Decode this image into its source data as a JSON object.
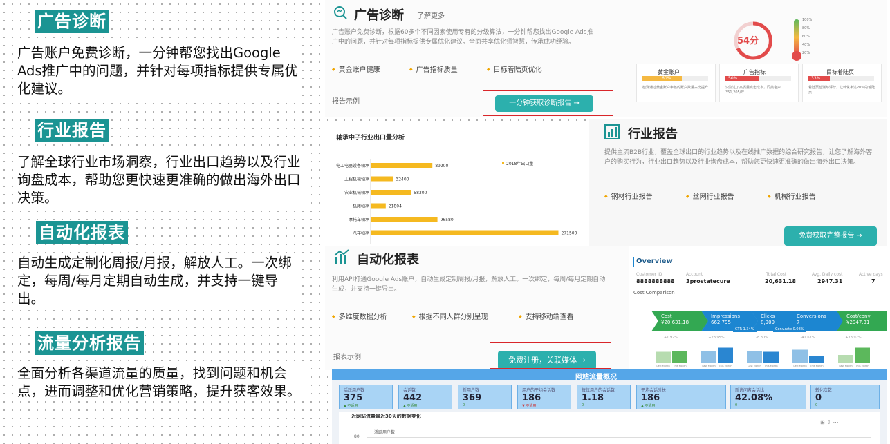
{
  "left": {
    "sections": [
      {
        "title": "广告诊断",
        "desc": "广告账户免费诊断，一分钟帮您找出Google Ads推广中的问题，并针对每项指标提供专属优化建议。"
      },
      {
        "title": "行业报告",
        "desc": "了解全球行业市场洞察，行业出口趋势以及行业询盘成本，帮助您更快速更准确的做出海外出口决策。"
      },
      {
        "title": "自动化报表",
        "desc": "自动生成定制化周报/月报，解放人工。一次绑定，每周/每月定期自动生成，并支持一键导出。"
      },
      {
        "title": "流量分析报告",
        "desc": "全面分析各渠道流量的质量，找到问题和机会点，进而调整和优化营销策略，提升获客效果。"
      }
    ]
  },
  "diag": {
    "title": "广告诊断",
    "learn_more": "了解更多",
    "desc": "广告账户免费诊断，根据60多个不同因素使用专有的分级算法，一分钟帮您找出Google Ads推广中的问题，并针对每项指标提供专属优化建议。全面共享优化师智慧，传承成功经验。",
    "bullets": [
      "黄金账户健康",
      "广告指标质量",
      "目标着陆页优化"
    ],
    "example": "报告示例",
    "button": "一分钟获取诊断报告 →",
    "score": "54分",
    "gauge_labels": [
      "100%",
      "80%",
      "60%",
      "40%",
      "20%"
    ],
    "cards": [
      {
        "name": "黄金账户",
        "pct": "60%",
        "fill": 0.6,
        "color": "#f5b942",
        "text": "检测通过黄金账户审核的账户数量占比提升"
      },
      {
        "name": "广告指标",
        "pct": "50%",
        "fill": 0.5,
        "color": "#e24b4b",
        "text": "识别过了高质量点击成本，同类客户351,205/年"
      },
      {
        "name": "目标着陆页",
        "pct": "33%",
        "fill": 0.33,
        "color": "#e24b4b",
        "text": "着陆页检测与评分，让转化率达20%的着陆页"
      }
    ]
  },
  "industry": {
    "title": "行业报告",
    "desc": "提供主流B2B行业，覆盖全球出口的行业趋势以及在线推广数据的综合研究报告，让您了解海外客户的购买行为，行业出口趋势以及行业询盘成本，帮助您更快速更准确的做出海外出口决策。",
    "bullets": [
      "钢材行业报告",
      "丝网行业报告",
      "机械行业报告"
    ],
    "button": "免费获取完整报告 →"
  },
  "chart_data": {
    "type": "bar",
    "title": "轴承中子行业出口量分析",
    "legend": "2018年出口量",
    "categories": [
      "电工电器设备轴承",
      "工程机械轴承",
      "农业机械轴承",
      "机床轴承",
      "摩托车轴承",
      "汽车轴承"
    ],
    "values": [
      89200,
      32400,
      58300,
      21804,
      96580,
      271500
    ],
    "value_labels": [
      "89200",
      "32400",
      "58300",
      "21804",
      "96580",
      "271500"
    ],
    "xlim": [
      0,
      290000
    ]
  },
  "auto": {
    "title": "自动化报表",
    "desc": "利用API打通Google Ads账户，自动生成定制周报/月报，解放人工。一次绑定，每周/每月定期自动生成，并支持一键导出。",
    "bullets": [
      "多维度数据分析",
      "根据不同人群分别呈现",
      "支持移动端查看"
    ],
    "example": "报表示例",
    "button": "免费注册，关联媒体 →",
    "overview": {
      "title": "Overview",
      "cols": [
        {
          "label": "Customer ID",
          "value": "8888888888"
        },
        {
          "label": "Account",
          "value": "3prostatecure"
        },
        {
          "label": "Total Cost",
          "value": "20,631.18"
        },
        {
          "label": "Avg. Daily cost",
          "value": "2947.31"
        },
        {
          "label": "Active days",
          "value": "7"
        }
      ],
      "compare": "Cost Comparison",
      "funnel": [
        {
          "name": "Cost",
          "value": "¥20,631.18",
          "color": "#33a852"
        },
        {
          "name": "Impressions",
          "value": "662,795",
          "color": "#1c86d1"
        },
        {
          "name": "Clicks",
          "value": "8,909",
          "color": "#1c86d1"
        },
        {
          "name": "Conversions",
          "value": "7",
          "color": "#1c86d1"
        },
        {
          "name": "Cost/conv",
          "value": "¥2947.31",
          "color": "#33a852"
        }
      ],
      "ctr": "CTR 1.34%",
      "conv_rate": "Conv.rate 0.08%",
      "bar_pairs": [
        {
          "change": "+1.92%",
          "last": 0.55,
          "this": 0.6,
          "c1": "#b7dcb0",
          "c2": "#5cb85c"
        },
        {
          "change": "+28.95%",
          "last": 0.6,
          "this": 0.75,
          "c1": "#8fc0e6",
          "c2": "#2a86d1"
        },
        {
          "change": "-8.80%",
          "last": 0.6,
          "this": 0.55,
          "c1": "#8fc0e6",
          "c2": "#2a86d1"
        },
        {
          "change": "-41.67%",
          "last": 0.65,
          "this": 0.35,
          "c1": "#8fc0e6",
          "c2": "#2a86d1"
        },
        {
          "change": "+73.92%",
          "last": 0.4,
          "this": 0.75,
          "c1": "#b7dcb0",
          "c2": "#5cb85c"
        }
      ],
      "bar_axis": [
        "Last Month",
        "This Month"
      ]
    }
  },
  "traffic": {
    "title": "网站流量概况",
    "tiles": [
      {
        "label": "活跃用户数",
        "value": "375",
        "sub": "▲ 不适用"
      },
      {
        "label": "会话数",
        "value": "442",
        "sub": "▲ 不适用"
      },
      {
        "label": "新用户数",
        "value": "369",
        "sub": "0"
      },
      {
        "label": "用户的平均会话数",
        "value": "186",
        "sub": "▼ 不适用"
      },
      {
        "label": "每位用户的会话数",
        "value": "1.18",
        "sub": "0"
      },
      {
        "label": "平均会话时长",
        "value": "186",
        "sub": "▲ 不适用"
      },
      {
        "label": "新访问者会话比",
        "value": "42.08%",
        "sub": "0"
      },
      {
        "label": "转化次数",
        "value": "0",
        "sub": "0"
      }
    ],
    "chart_title": "近网站流量最近30天的数据变化",
    "series_label": "活跃用户数",
    "axis_value": "80"
  }
}
